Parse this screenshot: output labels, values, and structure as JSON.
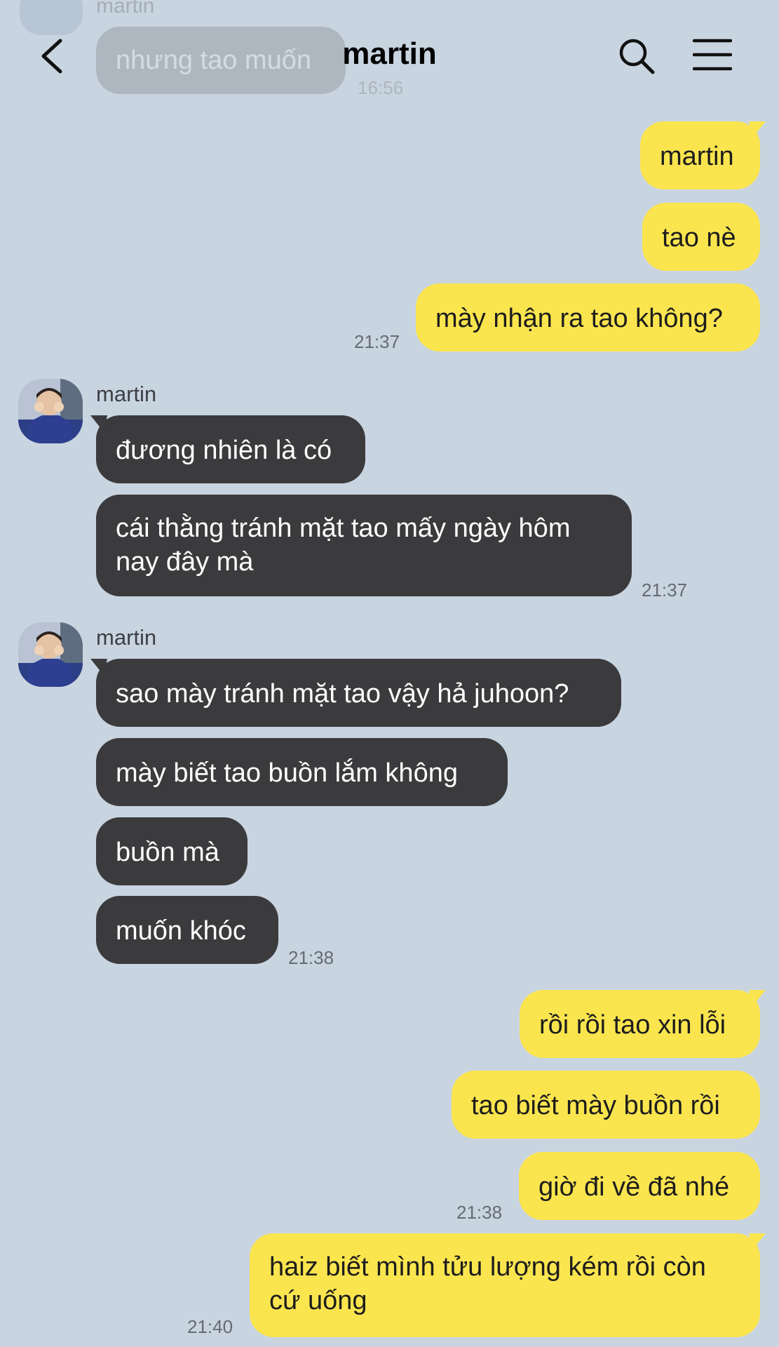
{
  "header": {
    "title": "martin",
    "back_icon": "chevron-left-icon",
    "search_icon": "search-icon",
    "menu_icon": "hamburger-menu-icon",
    "ghost": {
      "name": "martin",
      "text": "nhưng tao muốn",
      "time": "16:56"
    }
  },
  "colors": {
    "background": "#c9d4e1",
    "mine_bubble": "#fbe54f",
    "theirs_bubble": "#3b3b3d"
  },
  "messages": {
    "m1": "martin",
    "m2": "tao nè",
    "m3": "mày nhận ra tao không?",
    "t1": "21:37",
    "g1_name": "martin",
    "r1": "đương nhiên là có",
    "r2": "cái thằng tránh mặt tao mấy ngày hôm nay đây mà",
    "t2": "21:37",
    "g2_name": "martin",
    "r3": "sao mày tránh mặt tao vậy hả juhoon?",
    "r4": "mày biết tao buồn lắm không",
    "r5": "buồn mà",
    "r6": "muốn khóc",
    "t3": "21:38",
    "m4": "rồi rồi tao xin lỗi",
    "m5": "tao biết mày buồn rồi",
    "m6": "giờ đi về đã nhé",
    "t4": "21:38",
    "m7": "haiz biết mình tửu lượng kém rồi còn cứ uống",
    "t5": "21:40"
  }
}
